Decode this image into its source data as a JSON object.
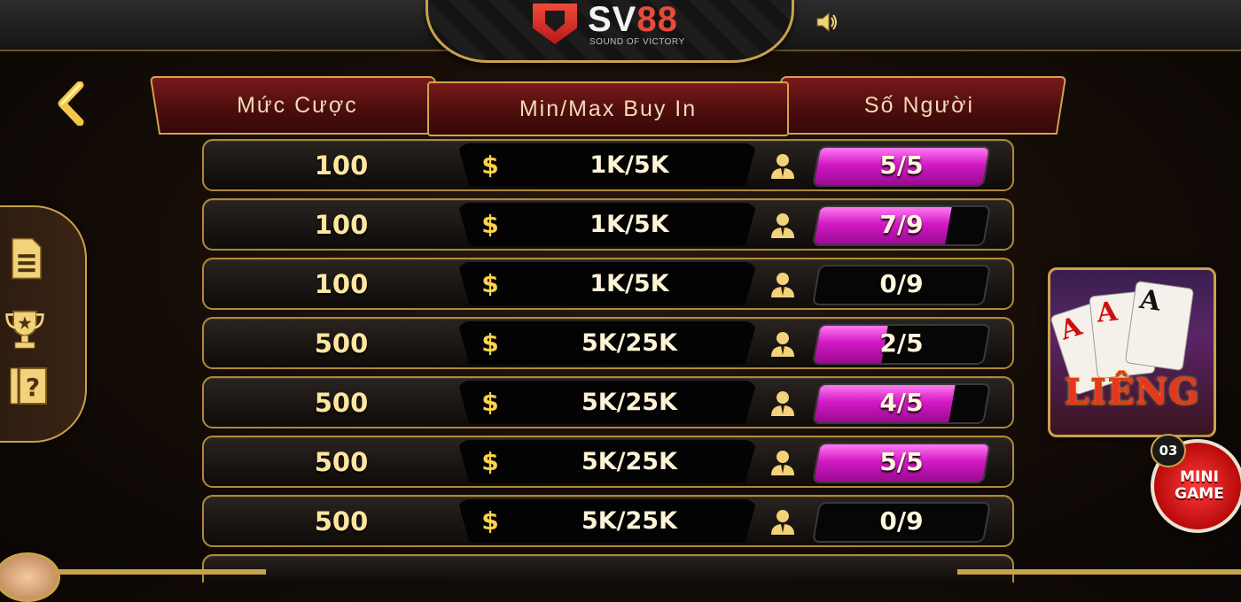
{
  "header": {
    "brand_prefix": "SV",
    "brand_accent": "88",
    "tagline": "SOUND OF VICTORY"
  },
  "icons": {
    "sound": "speaker-icon",
    "back": "chevron-left-icon",
    "rules": "document-icon",
    "ranking": "trophy-icon",
    "help": "help-icon",
    "player": "person-icon"
  },
  "table": {
    "columns": [
      "Mức Cược",
      "Min/Max Buy In",
      "Số Người"
    ],
    "currency_symbol": "$",
    "rows": [
      {
        "bet": "100",
        "buy_in": "1K/5K",
        "players": "5/5",
        "fill": 1.0
      },
      {
        "bet": "100",
        "buy_in": "1K/5K",
        "players": "7/9",
        "fill": 0.78
      },
      {
        "bet": "100",
        "buy_in": "1K/5K",
        "players": "0/9",
        "fill": 0.0
      },
      {
        "bet": "500",
        "buy_in": "5K/25K",
        "players": "2/5",
        "fill": 0.4
      },
      {
        "bet": "500",
        "buy_in": "5K/25K",
        "players": "4/5",
        "fill": 0.8
      },
      {
        "bet": "500",
        "buy_in": "5K/25K",
        "players": "5/5",
        "fill": 1.0
      },
      {
        "bet": "500",
        "buy_in": "5K/25K",
        "players": "0/9",
        "fill": 0.0
      }
    ]
  },
  "game_card": {
    "title": "LIÊNG",
    "cards": [
      "A",
      "A",
      "A"
    ]
  },
  "mini_game": {
    "label": "MINI GAME",
    "count": "03"
  },
  "colors": {
    "gold": "#c9a24a",
    "header_red": "#6a1414",
    "progress_magenta": "#d21ac4",
    "bet_text": "#ffe6a0"
  }
}
